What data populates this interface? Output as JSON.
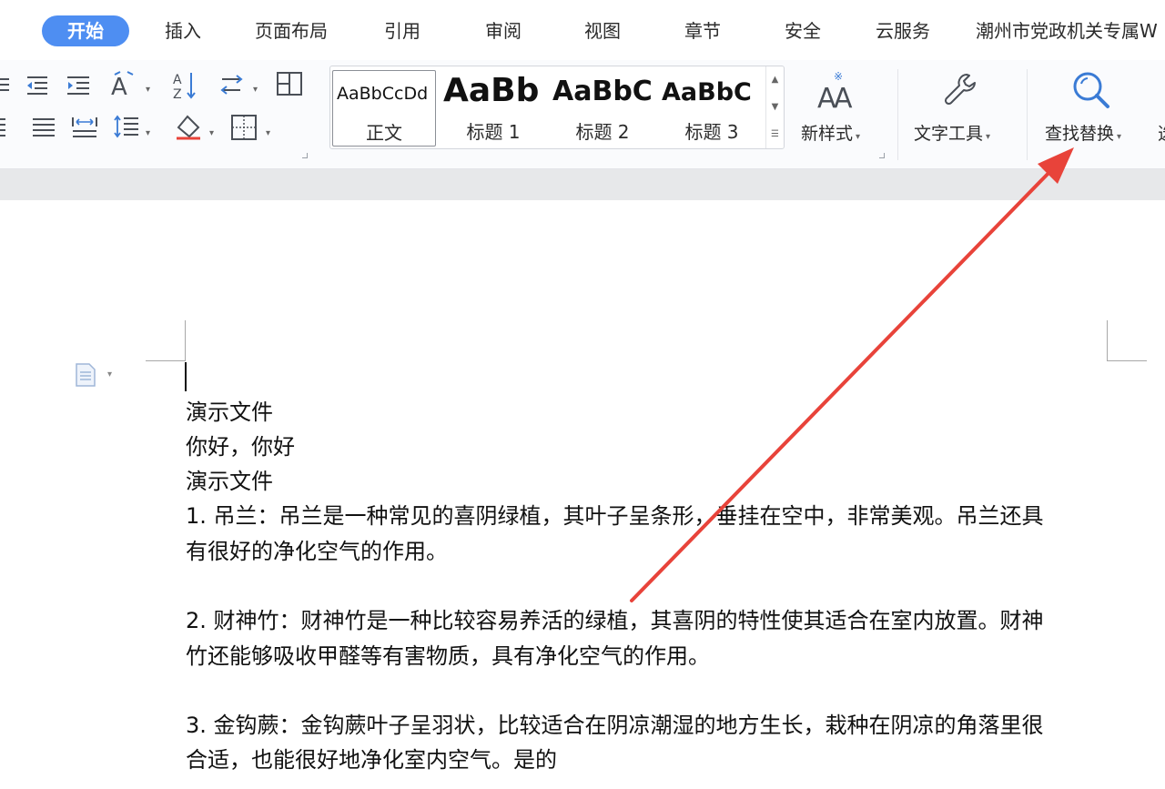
{
  "tabs": [
    {
      "label": "开始",
      "active": true
    },
    {
      "label": "插入"
    },
    {
      "label": "页面布局"
    },
    {
      "label": "引用"
    },
    {
      "label": "审阅"
    },
    {
      "label": "视图"
    },
    {
      "label": "章节"
    },
    {
      "label": "安全"
    },
    {
      "label": "云服务"
    },
    {
      "label": "潮州市党政机关专属W"
    }
  ],
  "ribbon": {
    "styles": [
      {
        "sample": "AaBbCcDd",
        "label": "正文"
      },
      {
        "sample": "AaBb",
        "label": "标题 1"
      },
      {
        "sample": "AaBbC",
        "label": "标题 2"
      },
      {
        "sample": "AaBbC",
        "label": "标题 3"
      }
    ],
    "new_style": "新样式",
    "text_tools": "文字工具",
    "find_replace": "查找替换"
  },
  "document": {
    "lines": [
      "演示文件",
      "你好，你好",
      "演示文件",
      "1. 吊兰：吊兰是一种常见的喜阴绿植，其叶子呈条形，垂挂在空中，非常美观。吊兰还具",
      "有很好的净化空气的作用。",
      "2. 财神竹：财神竹是一种比较容易养活的绿植，其喜阴的特性使其适合在室内放置。财神",
      "竹还能够吸收甲醛等有害物质，具有净化空气的作用。",
      "3. 金钩蕨：金钩蕨叶子呈羽状，比较适合在阴凉潮湿的地方生长，栽种在阴凉的角落里很",
      "合适，也能很好地净化室内空气。是的"
    ]
  },
  "colors": {
    "accent": "#4e8ef2",
    "arrow": "#e8433a"
  }
}
